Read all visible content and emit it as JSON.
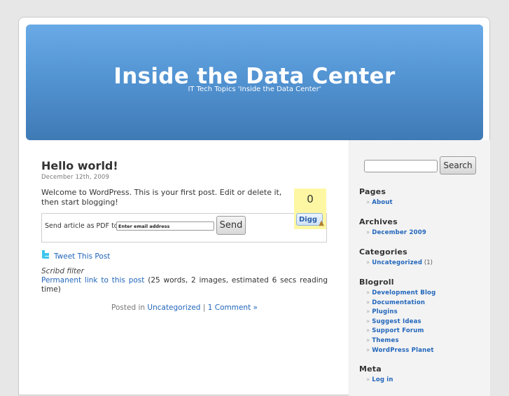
{
  "header": {
    "title": "Inside the Data Center",
    "description": "IT Tech Topics 'Inside the Data Center'"
  },
  "post": {
    "title": "Hello world!",
    "date": "December 12th, 2009",
    "body": "Welcome to WordPress. This is your first post. Edit or delete it, then start blogging!",
    "digg": {
      "count": "0",
      "button_label": "Digg"
    },
    "pdf": {
      "label": "Send article as PDF to",
      "input_value": "Enter email address",
      "send_label": "Send"
    },
    "tweet_label": "Tweet This Post",
    "scribd_label": "Scribd filter",
    "permalink_label": "Permanent link to this post",
    "stats": "(25 words, 2 images, estimated 6 secs reading time)",
    "meta": {
      "posted_in": "Posted in",
      "category": "Uncategorized",
      "separator": "|",
      "comments": "1 Comment »"
    }
  },
  "sidebar": {
    "search": {
      "input_value": "",
      "button_label": "Search"
    },
    "bullet": "»",
    "sections": [
      {
        "title": "Pages",
        "items": [
          {
            "label": "About"
          }
        ]
      },
      {
        "title": "Archives",
        "items": [
          {
            "label": "December 2009"
          }
        ]
      },
      {
        "title": "Categories",
        "items": [
          {
            "label": "Uncategorized",
            "count": "(1)"
          }
        ]
      },
      {
        "title": "Blogroll",
        "items": [
          {
            "label": "Development Blog"
          },
          {
            "label": "Documentation"
          },
          {
            "label": "Plugins"
          },
          {
            "label": "Suggest Ideas"
          },
          {
            "label": "Support Forum"
          },
          {
            "label": "Themes"
          },
          {
            "label": "WordPress Planet"
          }
        ]
      },
      {
        "title": "Meta",
        "items": [
          {
            "label": "Log in"
          }
        ]
      }
    ]
  },
  "colors": {
    "header_top": "#69aae6",
    "header_bottom": "#3f7ab5",
    "link": "#2266bb",
    "digg_bg": "#fdf7a3",
    "sidebar_bg": "#f3f3f3",
    "page_bg": "#e7e7e7"
  }
}
